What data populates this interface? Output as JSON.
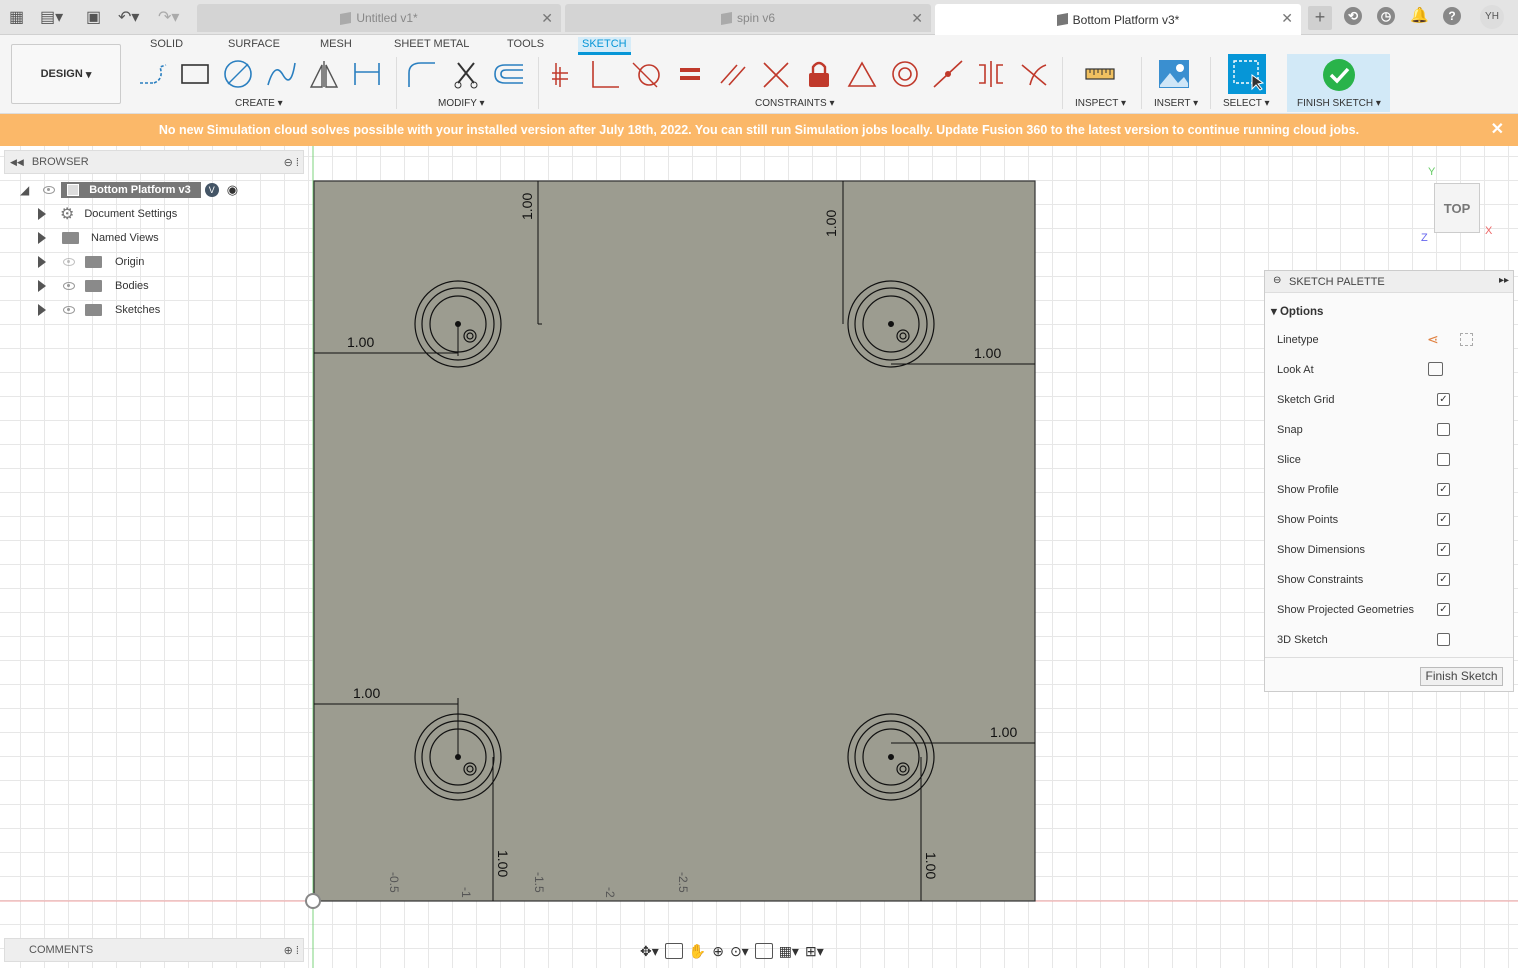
{
  "tabs": [
    {
      "label": "Untitled v1*",
      "active": false
    },
    {
      "label": "spin v6",
      "active": false
    },
    {
      "label": "Bottom Platform v3*",
      "active": true
    }
  ],
  "user_initials": "YH",
  "workspace_button": "DESIGN",
  "workspace_tabs": [
    "SOLID",
    "SURFACE",
    "MESH",
    "SHEET METAL",
    "TOOLS",
    "SKETCH"
  ],
  "groups": {
    "create": "CREATE",
    "modify": "MODIFY",
    "constraints": "CONSTRAINTS",
    "inspect": "INSPECT",
    "insert": "INSERT",
    "select": "SELECT",
    "finish": "FINISH SKETCH"
  },
  "banner": {
    "text": "No new Simulation cloud solves possible with your installed version after July 18th, 2022. You can still run Simulation jobs locally. Update Fusion 360 to the latest version to continue running cloud jobs.",
    "close": "✕"
  },
  "browser": {
    "title": "BROWSER",
    "root": "Bottom Platform v3",
    "items": [
      "Document Settings",
      "Named Views",
      "Origin",
      "Bodies",
      "Sketches"
    ]
  },
  "comments": "COMMENTS",
  "viewcube": {
    "face": "TOP",
    "axis_x": "X",
    "axis_y": "Y",
    "axis_z": "Z"
  },
  "palette": {
    "title": "SKETCH PALETTE",
    "section": "Options",
    "rows": [
      {
        "label": "Linetype",
        "kind": "icon"
      },
      {
        "label": "Look At",
        "kind": "icon"
      },
      {
        "label": "Sketch Grid",
        "checked": true
      },
      {
        "label": "Snap",
        "checked": false
      },
      {
        "label": "Slice",
        "checked": false
      },
      {
        "label": "Show Profile",
        "checked": true
      },
      {
        "label": "Show Points",
        "checked": true
      },
      {
        "label": "Show Dimensions",
        "checked": true
      },
      {
        "label": "Show Constraints",
        "checked": true
      },
      {
        "label": "Show Projected Geometries",
        "checked": true
      },
      {
        "label": "3D Sketch",
        "checked": false
      }
    ],
    "finish_button": "Finish Sketch"
  },
  "sketch": {
    "dimensions": {
      "top_left_v": "1.00",
      "top_left_h": "1.00",
      "top_right_v": "1.00",
      "top_right_h": "1.00",
      "bottom_left_h": "1.00",
      "bottom_left_v": "1.00",
      "bottom_right_h": "1.00",
      "bottom_right_v": "1.00"
    },
    "axis_ticks": [
      "-0.5",
      "-1",
      "-1.5",
      "-2",
      "-2.5"
    ]
  }
}
